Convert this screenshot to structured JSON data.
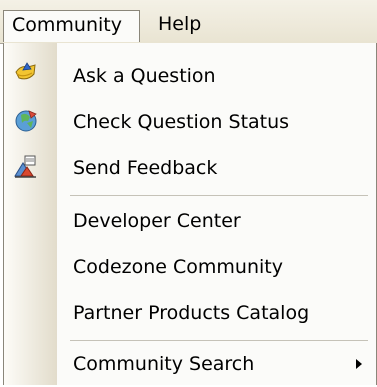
{
  "menubar": {
    "community_label": "Community",
    "help_label": "Help"
  },
  "menu": {
    "items": [
      {
        "label": "Ask a Question",
        "icon": "ask-question-icon"
      },
      {
        "label": "Check Question Status",
        "icon": "question-status-icon"
      },
      {
        "label": "Send Feedback",
        "icon": "feedback-icon"
      },
      {
        "label": "Developer Center"
      },
      {
        "label": "Codezone Community"
      },
      {
        "label": "Partner Products Catalog"
      },
      {
        "label": "Community Search",
        "icon": "submenu-arrow-icon"
      }
    ]
  }
}
